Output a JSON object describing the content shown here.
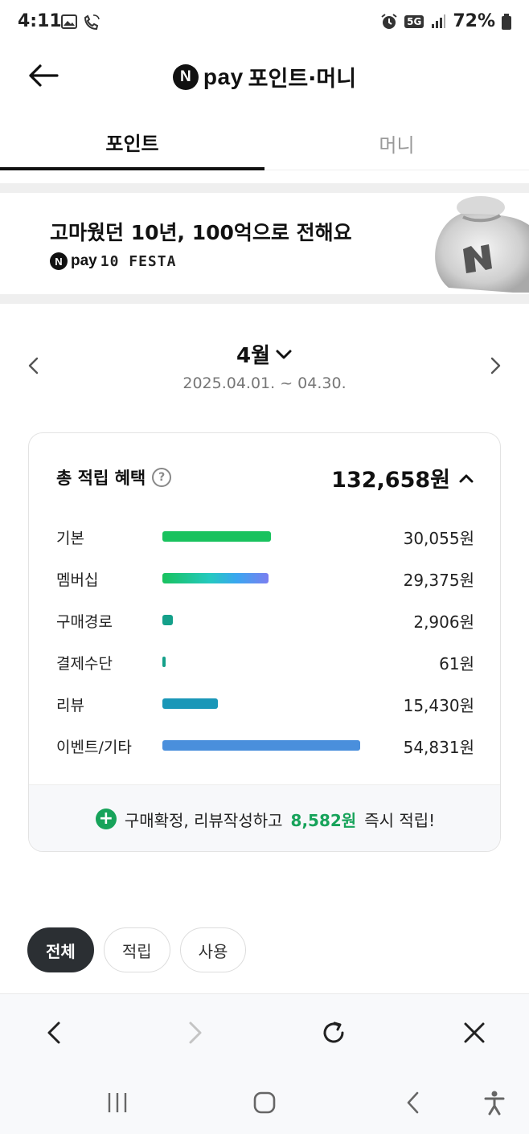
{
  "status_bar": {
    "time": "4:11",
    "battery": "72%",
    "network": "5G"
  },
  "header": {
    "logo_letter": "N",
    "brand": "pay",
    "title": "포인트·머니"
  },
  "tabs": [
    {
      "label": "포인트",
      "active": true
    },
    {
      "label": "머니",
      "active": false
    }
  ],
  "banner": {
    "title": "고마웠던 10년, 100억으로 전해요",
    "sub_logo_letter": "N",
    "sub_brand": "pay",
    "sub_event": "10 FESTA"
  },
  "period": {
    "month": "4월",
    "range": "2025.04.01. ~ 04.30."
  },
  "summary": {
    "title": "총 적립 혜택",
    "total": "132,658원",
    "rows": [
      {
        "label": "기본",
        "value": "30,055원",
        "amount": 30055,
        "color": "#19c25e"
      },
      {
        "label": "멤버십",
        "value": "29,375원",
        "amount": 29375,
        "color": "gradient"
      },
      {
        "label": "구매경로",
        "value": "2,906원",
        "amount": 2906,
        "color": "#14a08a"
      },
      {
        "label": "결제수단",
        "value": "61원",
        "amount": 61,
        "color": "#14a08a"
      },
      {
        "label": "리뷰",
        "value": "15,430원",
        "amount": 15430,
        "color": "#1a97b8"
      },
      {
        "label": "이벤트/기타",
        "value": "54,831원",
        "amount": 54831,
        "color": "#4a8fdc"
      }
    ],
    "footer": {
      "prefix": "구매확정, 리뷰작성하고",
      "amount": "8,582원",
      "suffix": "즉시 적립!"
    }
  },
  "filters": [
    {
      "label": "전체",
      "active": true
    },
    {
      "label": "적립",
      "active": false
    },
    {
      "label": "사용",
      "active": false
    }
  ],
  "icons": {
    "browser_bar": [
      "back-icon",
      "forward-icon",
      "refresh-icon",
      "close-icon"
    ],
    "system_nav": [
      "recents-icon",
      "home-icon",
      "back-icon",
      "accessibility-icon"
    ]
  }
}
